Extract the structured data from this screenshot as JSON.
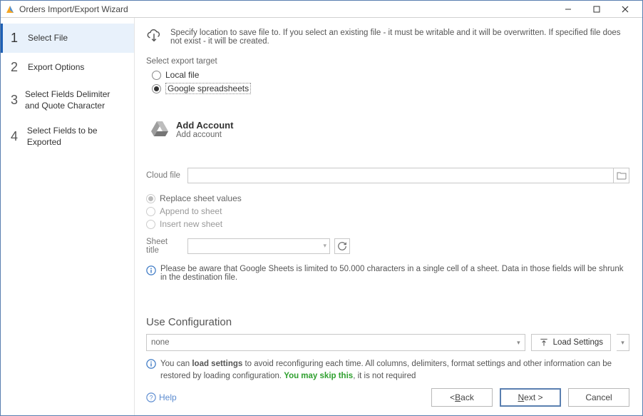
{
  "window": {
    "title": "Orders Import/Export Wizard"
  },
  "steps": [
    {
      "num": "1",
      "label": "Select File"
    },
    {
      "num": "2",
      "label": "Export Options"
    },
    {
      "num": "3",
      "label": "Select Fields Delimiter and Quote Character"
    },
    {
      "num": "4",
      "label": "Select Fields to be Exported"
    }
  ],
  "intro": "Specify location to save file to. If you select an existing file - it must be writable and it will be overwritten. If specified file does not exist - it will be created.",
  "export_target": {
    "label": "Select export target",
    "local": "Local file",
    "google": "Google spreadsheets"
  },
  "account": {
    "title": "Add Account",
    "subtitle": "Add account"
  },
  "cloud_file": {
    "label": "Cloud file",
    "value": ""
  },
  "sheet_mode": {
    "replace": "Replace sheet values",
    "append": "Append to sheet",
    "insert": "Insert new sheet"
  },
  "sheet_title": {
    "label": "Sheet title",
    "value": ""
  },
  "warning": "Please be aware that Google Sheets is limited to 50.000 characters in a single cell of a sheet. Data in those fields will be shrunk in the destination file.",
  "config": {
    "heading": "Use Configuration",
    "selected": "none",
    "load_btn": "Load Settings",
    "tip_a": "You can ",
    "tip_b": "load settings",
    "tip_c": " to avoid reconfiguring each time. All columns, delimiters, format settings and other information can be restored by loading configuration. ",
    "tip_d": "You may skip this",
    "tip_e": ", it is not required"
  },
  "footer": {
    "help": "Help",
    "back": "< Back",
    "next": "Next >",
    "cancel": "Cancel"
  }
}
